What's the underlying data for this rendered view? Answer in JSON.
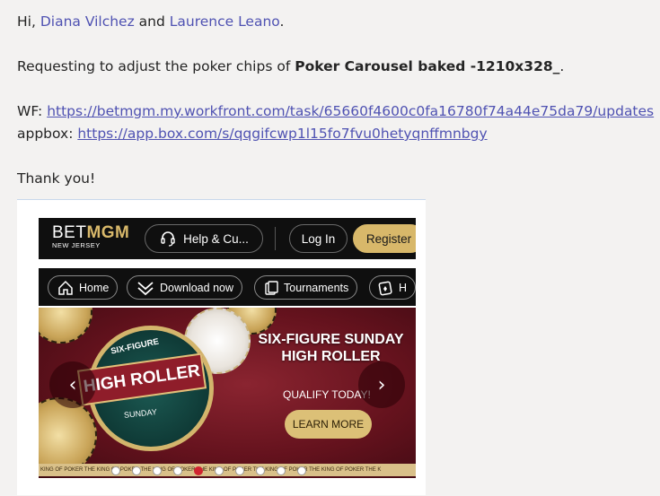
{
  "message": {
    "greeting_prefix": "Hi, ",
    "mention_1": "Diana Vilchez",
    "and_text": " and ",
    "mention_2": "Laurence Leano",
    "greeting_suffix": ".",
    "request_prefix": "Requesting to adjust the poker chips of ",
    "request_bold": "Poker Carousel baked -1210x328_",
    "request_suffix": ".",
    "wf_label": "WF: ",
    "wf_link": "https://betmgm.my.workfront.com/task/65660f4600c0fa16780f74a44e75da79/updates",
    "appbox_label": "appbox: ",
    "appbox_link": "https://app.box.com/s/qqgifcwp1l15fo7fvu0hetyqnffmnbgy",
    "thanks": "Thank you!"
  },
  "embedded": {
    "logo_text_bet": "BET",
    "logo_text_mgm": "MGM",
    "logo_sub": "NEW JERSEY",
    "help_label": "Help & Cu...",
    "login_label": "Log In",
    "register_label": "Register",
    "nav": [
      {
        "label": "Home",
        "icon": "home-icon"
      },
      {
        "label": "Download now",
        "icon": "download-chevron-icon"
      },
      {
        "label": "Tournaments",
        "icon": "tournaments-icon"
      },
      {
        "label": "H",
        "icon": "cards-icon"
      }
    ],
    "banner": {
      "title_line1": "SIX-FIGURE SUNDAY",
      "title_line2": "HIGH ROLLER",
      "qualify": "QUALIFY TODAY!",
      "learn_more": "LEARN MORE",
      "badge_top": "SIX-FIGURE",
      "badge_main": "HIGH ROLLER",
      "badge_bottom": "SUNDAY",
      "ticker": "KING OF POKER   THE KING OF POKER   THE KING OF POKER   THE KING OF POKER   THE KING OF POKER   THE KING OF POKER   THE K"
    },
    "carousel_dots": 10,
    "active_dot_index": 4
  },
  "colors": {
    "mention": "#4f52b2",
    "gold": "#d8b86a",
    "banner_red": "#64121d"
  }
}
